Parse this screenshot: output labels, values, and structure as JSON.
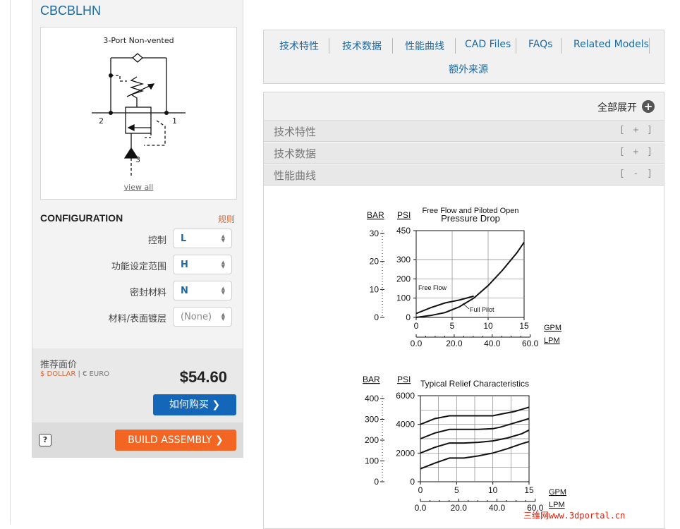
{
  "product": {
    "model": "CBCBLHN"
  },
  "schematic": {
    "title": "3-Port Non-vented",
    "port_labels": [
      "2",
      "1",
      "3"
    ],
    "view_all": "view all"
  },
  "configuration": {
    "title": "CONFIGURATION",
    "rules_link": "规则",
    "options": [
      {
        "label": "控制",
        "value": "L"
      },
      {
        "label": "功能设定范围",
        "value": "H"
      },
      {
        "label": "密封材料",
        "value": "N"
      },
      {
        "label": "材料/表面镀层",
        "value": "(None)"
      }
    ]
  },
  "pricing": {
    "label": "推荐面价",
    "currency_dollar": "$ DOLLAR",
    "currency_separator": " | ",
    "currency_euro": "€ EURO",
    "price": "$54.60",
    "buy_button": "如何购买 ❯",
    "help_button": "?",
    "build_button": "BUILD ASSEMBLY ❯"
  },
  "tabs": [
    "技术特性",
    "技术数据",
    "性能曲线",
    "CAD Files",
    "FAQs",
    "Related Models",
    "额外来源"
  ],
  "accordion": {
    "expand_all": "全部展开",
    "expand_icon": "+",
    "sections": [
      {
        "label": "技术特性",
        "toggle": "[ + ]"
      },
      {
        "label": "技术数据",
        "toggle": "[ + ]"
      },
      {
        "label": "性能曲线",
        "toggle": "[ - ]"
      }
    ]
  },
  "chart_data": [
    {
      "type": "line",
      "title": "Free Flow and Piloted Open",
      "subtitle": "Pressure Drop",
      "y_axis_labels": [
        "BAR",
        "PSI"
      ],
      "y_ticks_bar": [
        "30",
        "20",
        "10",
        "0"
      ],
      "y_ticks_psi": [
        "450",
        "300",
        "200",
        "100",
        "0"
      ],
      "x_ticks_gpm": [
        "0",
        "5",
        "10",
        "15"
      ],
      "x_ticks_lpm": [
        "0.0",
        "20.0",
        "40.0",
        "60.0"
      ],
      "x_unit_gpm": "GPM",
      "x_unit_lpm": "LPM",
      "xlim": [
        0,
        15
      ],
      "ylim": [
        0,
        450
      ],
      "grid": true,
      "series": [
        {
          "name": "Free Flow",
          "x": [
            0,
            2,
            4,
            6,
            8
          ],
          "y": [
            20,
            50,
            75,
            90,
            110
          ]
        },
        {
          "name": "Full Pilot",
          "x": [
            0,
            2,
            4,
            6,
            8,
            10,
            12,
            14,
            15
          ],
          "y": [
            0,
            10,
            25,
            55,
            100,
            165,
            245,
            335,
            390
          ]
        }
      ]
    },
    {
      "type": "line",
      "title": "Typical Relief Characteristics",
      "y_axis_labels": [
        "BAR",
        "PSI"
      ],
      "y_ticks_bar": [
        "400",
        "300",
        "200",
        "100",
        "0"
      ],
      "y_ticks_psi": [
        "6000",
        "4000",
        "2000",
        "0"
      ],
      "x_ticks_gpm": [
        "0",
        "5",
        "10",
        "15"
      ],
      "x_ticks_lpm": [
        "0.0",
        "20.0",
        "40.0",
        "60.0"
      ],
      "x_unit_gpm": "GPM",
      "x_unit_lpm": "LPM",
      "xlim": [
        0,
        15
      ],
      "ylim": [
        0,
        6000
      ],
      "grid": true,
      "series": [
        {
          "x": [
            0,
            2,
            4,
            6,
            8,
            10,
            11,
            13,
            15
          ],
          "y": [
            4000,
            4400,
            4600,
            4600,
            4600,
            4600,
            4700,
            4900,
            5200
          ]
        },
        {
          "x": [
            0,
            2,
            4,
            6,
            8,
            10,
            11,
            13,
            15
          ],
          "y": [
            3000,
            3400,
            3650,
            3650,
            3650,
            3700,
            3800,
            4100,
            4400
          ]
        },
        {
          "x": [
            0,
            2,
            4,
            6,
            8,
            10,
            12,
            14,
            15
          ],
          "y": [
            2000,
            2400,
            2700,
            2700,
            2750,
            2850,
            3050,
            3350,
            3600
          ]
        },
        {
          "x": [
            0,
            2,
            4,
            6,
            8,
            10,
            12,
            14,
            15
          ],
          "y": [
            900,
            1300,
            1650,
            1650,
            1800,
            2000,
            2300,
            2650,
            2800
          ]
        }
      ]
    }
  ],
  "watermark": "三维网www.3dportal.cn"
}
